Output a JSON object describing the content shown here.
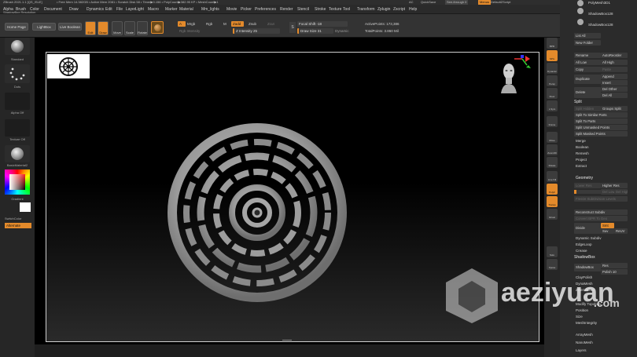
{
  "titlebar": {
    "app": "ZBrush 2021.1.1 [QS_ISLE]",
    "stats": "• Free Mem 14.382GB • Active Mem 2081 • Scratch Disk 58 • Timer▶0.156 • PolyCount▶382.95 KP • MeshCount▶1",
    "ac": "AC",
    "quicksave": "QuickSave",
    "seethrough": "See-through 0",
    "menus": "Menus",
    "script": "DefaultZScript"
  },
  "menubar": {
    "items": [
      "Alpha",
      "Brush",
      "Color",
      "Document",
      "Draw",
      "Dynamics",
      "Edit",
      "File",
      "Layer",
      "Light",
      "Macro",
      "Marker",
      "Material",
      "Mm_lights",
      "Movie",
      "Picker",
      "Preferences",
      "Render",
      "Stencil",
      "Stroke",
      "Texture",
      "Tool",
      "Transform",
      "Zplugin",
      "Zscript",
      "Help"
    ],
    "status": "ShadowBox Resolution"
  },
  "toolbar": {
    "home": "Home Page",
    "lightbox": "LightBox",
    "live_boolean": "Live Boolean",
    "edit": "Edit",
    "draw": "Draw",
    "move": "Move",
    "scale": "Scale",
    "rotate": "Rotate",
    "a_label": "A",
    "mrgb": "Mrgb",
    "rgb": "Rgb",
    "m": "M",
    "zadd": "Zadd",
    "zsub": "Zsub",
    "zcut": "Zcut",
    "rgb_intensity": "Rgb Intensity",
    "z_intensity": "Z Intensity 25",
    "focal_shift": "Focal Shift -18",
    "draw_size": "Draw Size 31",
    "dynamic": "Dynamic",
    "active_points": "ActivePoints: 173,386",
    "total_points": "TotalPoints: 3.860 Mil"
  },
  "leftshelf": {
    "standard": "Standard",
    "dots": "Dots",
    "alpha_off": "Alpha Off",
    "texture_off": "Texture Off",
    "material": "BasicMaterial2",
    "gradient": "Gradient",
    "switch_color": "SwitchColor",
    "alternate": "Alternate"
  },
  "rightshelf": [
    "BPR",
    "SPix",
    "Dynamic",
    "Persp",
    "Floor",
    "L.Sym",
    "Frame",
    "Move",
    "Zoom3D",
    "Rotate",
    "Line Fill",
    "PolyF",
    "Transp",
    "Ghost",
    "Solo",
    "Xpose"
  ],
  "palette": {
    "subtools": [
      "PolyMesh3D1",
      "ShadowBox128",
      "ShadowBox128"
    ],
    "list_all": "List All",
    "new_folder": "New Folder",
    "rename": "Rename",
    "autoreorder": "AutoReorder",
    "all_low": "All Low",
    "all_high": "All High",
    "copy": "Copy",
    "paste": "Paste",
    "duplicate": "Duplicate",
    "append": "Append",
    "insert": "Insert",
    "delete": "Delete",
    "del_other": "Del Other",
    "del_all": "Del All",
    "split": "Split",
    "split_hidden": "Split Hidden",
    "groups_split": "Groups Split",
    "split_similar": "Split To Similar Parts",
    "split_parts": "Split To Parts",
    "split_unmasked": "Split Unmasked Points",
    "split_masked": "Split Masked Points",
    "merge": "Merge",
    "boolean": "Boolean",
    "remesh": "Remesh",
    "project": "Project",
    "extract": "Extract",
    "geometry": "Geometry",
    "lower_res": "Lower Res",
    "higher_res": "Higher Res",
    "sdiv": "SDiv",
    "del_lower": "Del Lower",
    "del_higher": "Del Higher",
    "freeze": "Freeze SubDivision Levels",
    "reconstruct": "Reconstruct Subdiv",
    "convert_bpr": "Convert BPR To Geo",
    "divide": "Divide",
    "smt": "Smt",
    "suv": "Suv",
    "rsm": "ReUV",
    "dynamic_subdiv": "Dynamic Subdiv",
    "edgeloop": "EdgeLoop",
    "crease": "Crease",
    "shadowbox_head": "ShadowBox",
    "shadowbox": "ShadowBox",
    "polish": "Polish 10",
    "claypolish": "ClayPolish",
    "dynamesh": "DynaMesh",
    "zremesher": "ZRemesher",
    "modify_topology": "Modify Topology",
    "position": "Position",
    "size": "Size",
    "meshintegrity": "MeshIntegrity",
    "arraymesh": "ArrayMesh",
    "nanomesh": "NanoMesh",
    "layers": "Layers"
  },
  "watermark": {
    "text": "aeziyuan",
    "tld": ".com"
  },
  "colors": {
    "accent": "#e38a2b",
    "panel": "#2b2b2b",
    "viewport": "#000000"
  }
}
